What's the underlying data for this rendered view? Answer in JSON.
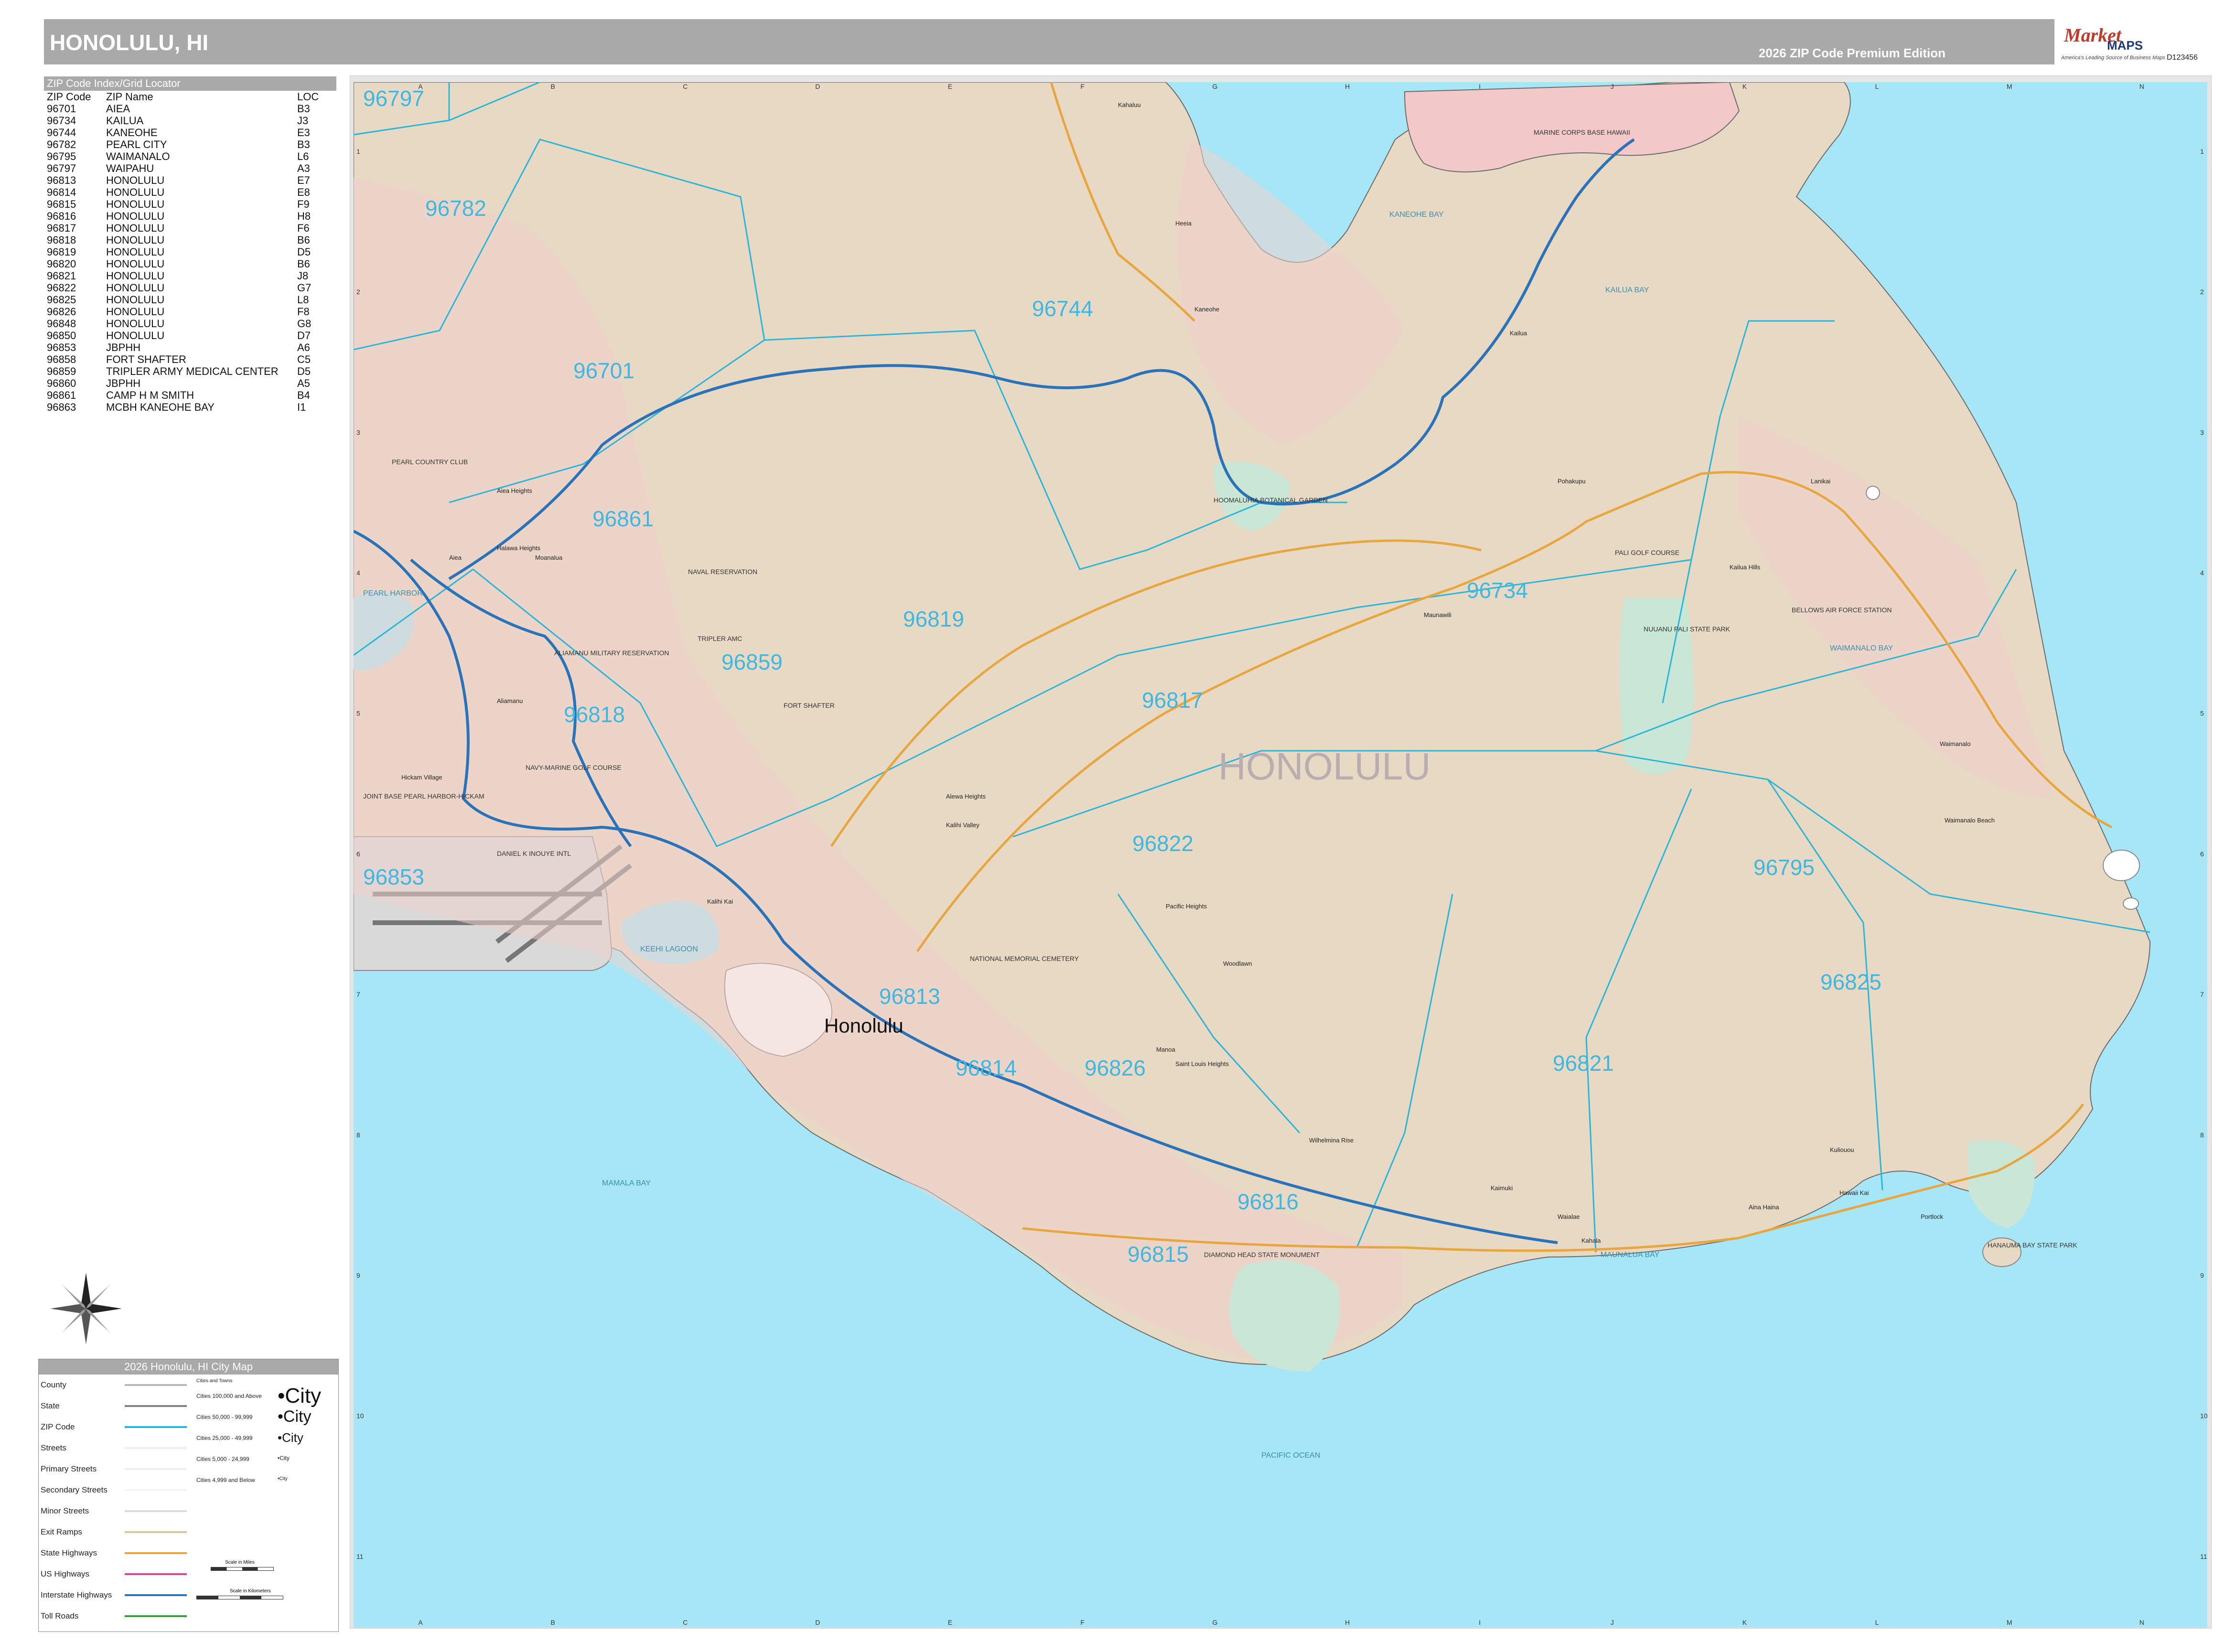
{
  "header": {
    "title": "HONOLULU, HI",
    "edition": "2026 ZIP Code Premium Edition",
    "logo_brand": "Market",
    "logo_maps": "MAPS",
    "logo_tagline": "America's Leading Source of Business Maps",
    "doc_id": "D123456"
  },
  "zip_index": {
    "heading": "ZIP Code Index/Grid Locator",
    "columns": [
      "ZIP Code",
      "ZIP Name",
      "LOC"
    ],
    "rows": [
      [
        "96701",
        "AIEA",
        "B3"
      ],
      [
        "96734",
        "KAILUA",
        "J3"
      ],
      [
        "96744",
        "KANEOHE",
        "E3"
      ],
      [
        "96782",
        "PEARL CITY",
        "B3"
      ],
      [
        "96795",
        "WAIMANALO",
        "L6"
      ],
      [
        "96797",
        "WAIPAHU",
        "A3"
      ],
      [
        "96813",
        "HONOLULU",
        "E7"
      ],
      [
        "96814",
        "HONOLULU",
        "E8"
      ],
      [
        "96815",
        "HONOLULU",
        "F9"
      ],
      [
        "96816",
        "HONOLULU",
        "H8"
      ],
      [
        "96817",
        "HONOLULU",
        "F6"
      ],
      [
        "96818",
        "HONOLULU",
        "B6"
      ],
      [
        "96819",
        "HONOLULU",
        "D5"
      ],
      [
        "96820",
        "HONOLULU",
        "B6"
      ],
      [
        "96821",
        "HONOLULU",
        "J8"
      ],
      [
        "96822",
        "HONOLULU",
        "G7"
      ],
      [
        "96825",
        "HONOLULU",
        "L8"
      ],
      [
        "96826",
        "HONOLULU",
        "F8"
      ],
      [
        "96848",
        "HONOLULU",
        "G8"
      ],
      [
        "96850",
        "HONOLULU",
        "D7"
      ],
      [
        "96853",
        "JBPHH",
        "A6"
      ],
      [
        "96858",
        "FORT SHAFTER",
        "C5"
      ],
      [
        "96859",
        "TRIPLER ARMY MEDICAL CENTER",
        "D5"
      ],
      [
        "96860",
        "JBPHH",
        "A5"
      ],
      [
        "96861",
        "CAMP H M SMITH",
        "B4"
      ],
      [
        "96863",
        "MCBH KANEOHE BAY",
        "I1"
      ]
    ]
  },
  "grid": {
    "columns": [
      "A",
      "B",
      "C",
      "D",
      "E",
      "F",
      "G",
      "H",
      "I",
      "J",
      "K",
      "L",
      "M",
      "N"
    ],
    "rows": [
      "1",
      "2",
      "3",
      "4",
      "5",
      "6",
      "7",
      "8",
      "9",
      "10",
      "11"
    ]
  },
  "map": {
    "city_label": "HONOLULU",
    "downtown_label": "Honolulu",
    "zip_labels": [
      "96797",
      "96782",
      "96701",
      "96744",
      "96861",
      "96819",
      "96859",
      "96818",
      "96817",
      "96734",
      "96853",
      "96822",
      "96795",
      "96813",
      "96814",
      "96826",
      "96825",
      "96821",
      "96816",
      "96815"
    ],
    "water_labels": [
      "KANEOHE BAY",
      "KAILUA BAY",
      "WAIMANALO BAY",
      "PEARL HARBOR",
      "KEEHI LAGOON",
      "MAMALA BAY",
      "MAUNALUA BAY",
      "PACIFIC OCEAN"
    ],
    "place_labels": [
      "Kaneohe",
      "Kailua",
      "Lanikai",
      "Waimanalo",
      "Waimanalo Beach",
      "Kahaluu",
      "Heeia",
      "Maunawili",
      "Kuliouou",
      "Hawaii Kai",
      "Portlock",
      "Aina Haina",
      "Waialae",
      "Kahala",
      "Kaimuki",
      "Manoa",
      "Woodlawn",
      "Pacific Heights",
      "Alewa Heights",
      "Kalihi Valley",
      "Kalihi Kai",
      "Aiea Heights",
      "Halawa Heights",
      "Aiea",
      "Moanalua",
      "Aliamanu",
      "Hickam Village",
      "Saint Louis Heights",
      "Wilhelmina Rise",
      "Pohakupu",
      "Kailua Hills"
    ],
    "feature_labels": [
      "MARINE CORPS BASE HAWAII",
      "BELLOWS AIR FORCE STATION",
      "PEARL COUNTRY CLUB",
      "NAVAL RESERVATION",
      "TRIPLER AMC",
      "ALIAMANU MILITARY RESERVATION",
      "FORT SHAFTER",
      "JOINT BASE PEARL HARBOR-HICKAM",
      "DANIEL K INOUYE INTL",
      "NUUANU PALI STATE PARK",
      "PALI GOLF COURSE",
      "HOOMALUHIA BOTANICAL GARDEN",
      "NATIONAL MEMORIAL CEMETERY",
      "DIAMOND HEAD STATE MONUMENT",
      "HANAUMA BAY STATE PARK",
      "NAVY-MARINE GOLF COURSE"
    ]
  },
  "legend": {
    "title": "2026 Honolulu, HI City Map",
    "items": [
      {
        "label": "County",
        "color": "#b8b8b8"
      },
      {
        "label": "State",
        "color": "#808080"
      },
      {
        "label": "ZIP Code",
        "color": "#2bb5d8"
      },
      {
        "label": "Streets",
        "color": "#f0f0f0"
      },
      {
        "label": "Primary Streets",
        "color": "#eeeeee"
      },
      {
        "label": "Secondary Streets",
        "color": "#f4f4f4"
      },
      {
        "label": "Minor Streets",
        "color": "#dcdcdc"
      },
      {
        "label": "Exit Ramps",
        "color": "#d9c7a0"
      },
      {
        "label": "State Highways",
        "color": "#e8a640"
      },
      {
        "label": "US Highways",
        "color": "#d04a9a"
      },
      {
        "label": "Interstate Highways",
        "color": "#2b73b8"
      },
      {
        "label": "Toll Roads",
        "color": "#3aa03a"
      }
    ],
    "cities_heading": "Cities and Towns",
    "city_classes": [
      {
        "label": "Cities 100,000 and Above",
        "sample": "•City"
      },
      {
        "label": "Cities 50,000 - 99,999",
        "sample": "•City"
      },
      {
        "label": "Cities 25,000 - 49,999",
        "sample": "•City"
      },
      {
        "label": "Cities 5,000 - 24,999",
        "sample": "•City"
      },
      {
        "label": "Cities 4,999 and Below",
        "sample": "•City"
      }
    ],
    "scale_miles": "Scale in Miles",
    "scale_km": "Scale in Kilometers"
  },
  "colors": {
    "water": "#a6e6f7",
    "land": "#e8d9c4",
    "urban": "#f2c8c8",
    "park": "#c9e6d6",
    "zip_line": "#2bb5d8",
    "zip_text": "#3fb7e0",
    "interstate": "#2b73b8",
    "state_hwy": "#e8a640"
  }
}
